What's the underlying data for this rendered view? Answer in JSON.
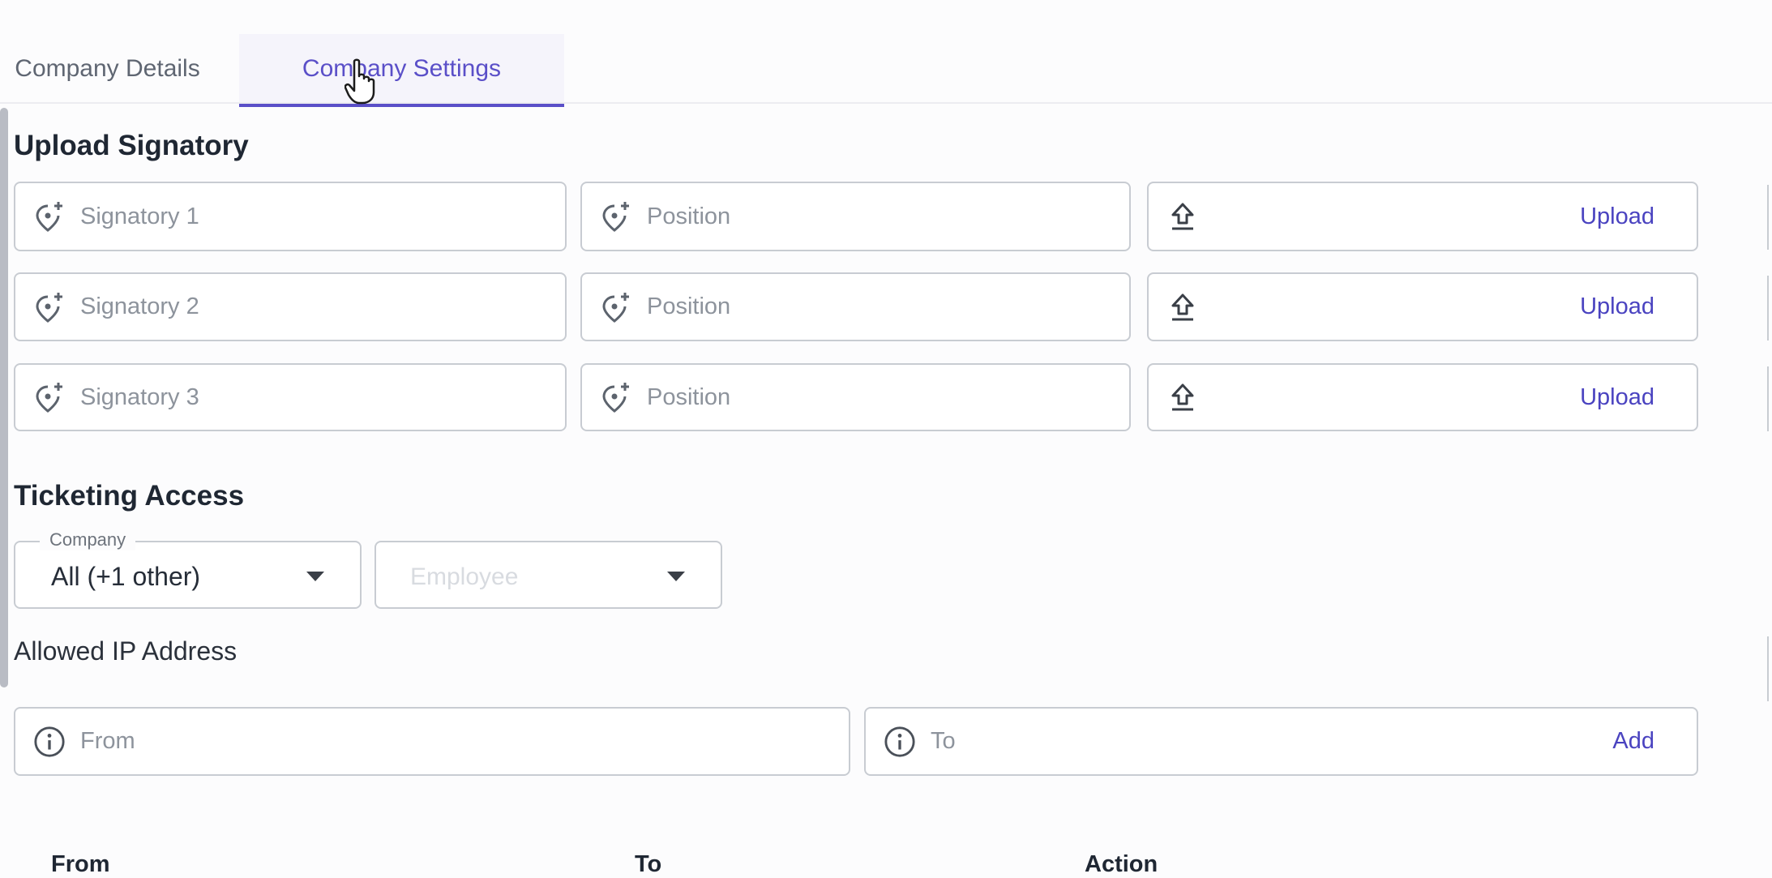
{
  "tabs": [
    {
      "label": "Company Details"
    },
    {
      "label": "Company Settings"
    }
  ],
  "upload_signatory": {
    "title": "Upload Signatory",
    "rows": [
      {
        "name_placeholder": "Signatory 1",
        "position_placeholder": "Position",
        "upload_label": "Upload"
      },
      {
        "name_placeholder": "Signatory 2",
        "position_placeholder": "Position",
        "upload_label": "Upload"
      },
      {
        "name_placeholder": "Signatory 3",
        "position_placeholder": "Position",
        "upload_label": "Upload"
      }
    ]
  },
  "ticketing_access": {
    "title": "Ticketing Access",
    "company_legend": "Company",
    "company_value": "All (+1 other)",
    "employee_placeholder": "Employee"
  },
  "allowed_ip": {
    "label": "Allowed IP Address",
    "from_placeholder": "From",
    "to_placeholder": "To",
    "add_label": "Add"
  },
  "table": {
    "headers": [
      "From",
      "To",
      "Action"
    ]
  },
  "colors": {
    "accent": "#5a4fc8",
    "border": "#c8ccd2",
    "scrollbar": "#b9bcc4"
  },
  "icons": {
    "signatory": "add-location-icon",
    "upload": "upload-arrow-icon",
    "ip": "info-circle-icon",
    "dropdown": "caret-down-icon",
    "pointer": "hand-pointer-icon"
  }
}
